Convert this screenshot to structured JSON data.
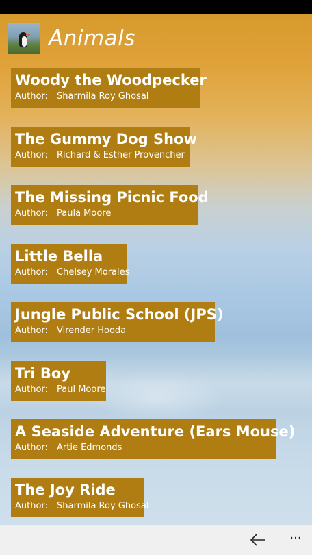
{
  "header": {
    "title": "Animals"
  },
  "author_label": "Author:",
  "stories": [
    {
      "title": "Woody the Woodpecker",
      "author": "Sharmila Roy Ghosal"
    },
    {
      "title": "The Gummy Dog Show",
      "author": "Richard & Esther Provencher"
    },
    {
      "title": "The Missing Picnic Food",
      "author": "Paula Moore"
    },
    {
      "title": "Little Bella",
      "author": "Chelsey Morales"
    },
    {
      "title": "Jungle Public School (JPS)",
      "author": "Virender Hooda"
    },
    {
      "title": "Tri Boy",
      "author": "Paul Moore"
    },
    {
      "title": "A Seaside Adventure (Ears Mouse)",
      "author": "Artie Edmonds"
    },
    {
      "title": "The Joy Ride",
      "author": "Sharmila Roy Ghosal"
    }
  ],
  "appbar": {
    "back_icon": "back-arrow-icon",
    "more_label": "···"
  },
  "colors": {
    "item_bg": "#b07d12",
    "appbar_bg": "#f0f0f0",
    "text": "#ffffff"
  }
}
